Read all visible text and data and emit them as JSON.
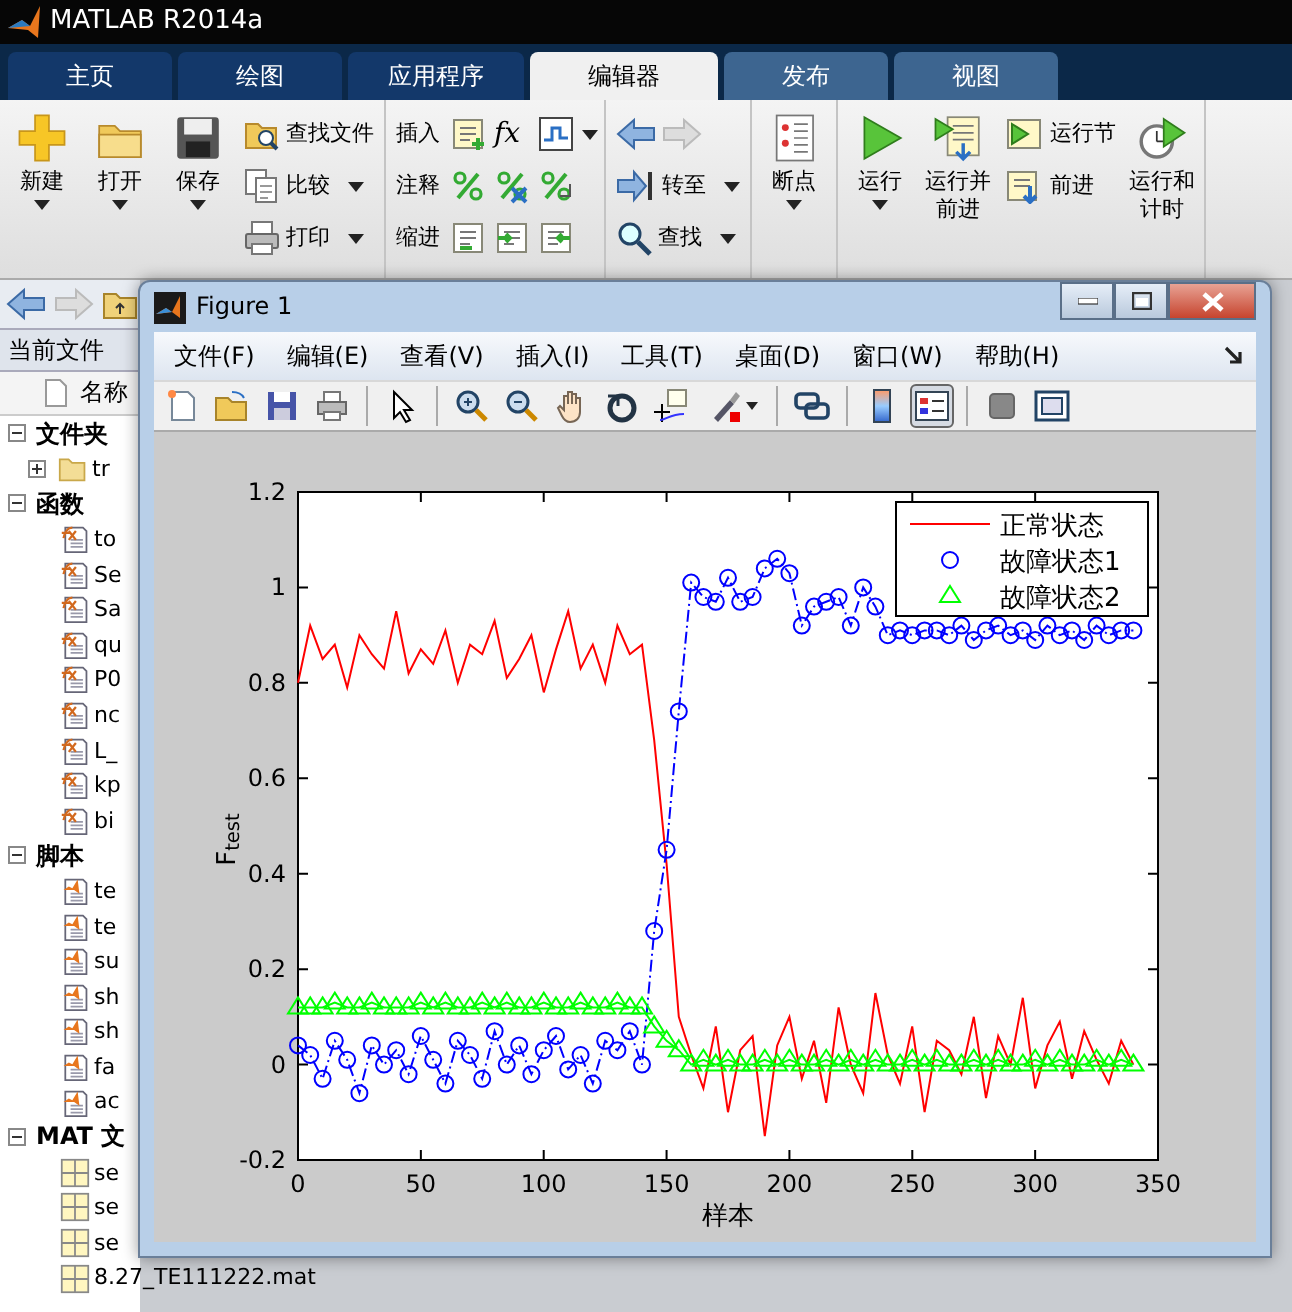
{
  "app": {
    "title": "MATLAB R2014a"
  },
  "tabs": [
    {
      "label": "主页",
      "selected": false,
      "contextual": false
    },
    {
      "label": "绘图",
      "selected": false,
      "contextual": false
    },
    {
      "label": "应用程序",
      "selected": false,
      "contextual": false
    },
    {
      "label": "编辑器",
      "selected": true,
      "contextual": true
    },
    {
      "label": "发布",
      "selected": false,
      "contextual": true
    },
    {
      "label": "视图",
      "selected": false,
      "contextual": true
    }
  ],
  "toolstrip": {
    "groups": [
      {
        "columns": [
          {
            "kind": "large",
            "label": "新建",
            "caret": true
          },
          {
            "kind": "large",
            "label": "打开",
            "caret": true
          },
          {
            "kind": "large",
            "label": "保存",
            "caret": true
          },
          {
            "kind": "stack",
            "rows": [
              {
                "kind": "text",
                "label": "查找文件",
                "caret": false
              },
              {
                "kind": "text",
                "label": "比较",
                "caret": true
              },
              {
                "kind": "text",
                "label": "打印",
                "caret": true
              }
            ]
          }
        ]
      },
      {
        "columns": [
          {
            "kind": "stack",
            "rows": [
              {
                "kind": "text",
                "label": "插入",
                "caret": false
              },
              {
                "kind": "text",
                "label": "注释",
                "caret": false
              },
              {
                "kind": "text",
                "label": "缩进",
                "caret": false
              }
            ]
          },
          {
            "kind": "icon-grid",
            "function_label": "fx",
            "caret": true
          }
        ]
      },
      {
        "columns": [
          {
            "kind": "stack",
            "rows": [
              {
                "kind": "arrows"
              },
              {
                "kind": "text",
                "label": "转至",
                "caret": true
              },
              {
                "kind": "text",
                "label": "查找",
                "caret": true
              }
            ]
          }
        ]
      },
      {
        "columns": [
          {
            "kind": "large",
            "label": "断点",
            "caret": true
          }
        ]
      },
      {
        "columns": [
          {
            "kind": "large",
            "label": "运行",
            "caret": true
          },
          {
            "kind": "large",
            "label": "运行并前进",
            "caret": false
          },
          {
            "kind": "stack",
            "rows": [
              {
                "kind": "text",
                "label": "运行节",
                "caret": false
              },
              {
                "kind": "text",
                "label": "前进",
                "caret": false
              }
            ]
          },
          {
            "kind": "large",
            "label": "运行和计时",
            "caret": false
          }
        ]
      }
    ]
  },
  "current_folder": {
    "title": "当前文件",
    "column": "名称",
    "sections": [
      {
        "label": "文件夹",
        "kind": "folder",
        "expanded": true,
        "items": [
          {
            "label": "tr",
            "expanded": false
          }
        ]
      },
      {
        "label": "函数",
        "kind": "function",
        "expanded": true,
        "items": [
          {
            "label": "to"
          },
          {
            "label": "Se"
          },
          {
            "label": "Sa"
          },
          {
            "label": "qu"
          },
          {
            "label": "P0"
          },
          {
            "label": "nc"
          },
          {
            "label": "L_"
          },
          {
            "label": "kp"
          },
          {
            "label": "bi"
          }
        ]
      },
      {
        "label": "脚本",
        "kind": "script",
        "expanded": true,
        "items": [
          {
            "label": "te"
          },
          {
            "label": "te"
          },
          {
            "label": "su"
          },
          {
            "label": "sh"
          },
          {
            "label": "sh"
          },
          {
            "label": "fa"
          },
          {
            "label": "ac"
          }
        ]
      },
      {
        "label": "MAT 文",
        "kind": "mat",
        "expanded": true,
        "items": [
          {
            "label": "se"
          },
          {
            "label": "se"
          },
          {
            "label": "se"
          },
          {
            "label": "8.27_TE111222.mat"
          }
        ]
      }
    ]
  },
  "figure": {
    "title": "Figure 1",
    "menus": [
      "文件(F)",
      "编辑(E)",
      "查看(V)",
      "插入(I)",
      "工具(T)",
      "桌面(D)",
      "窗口(W)",
      "帮助(H)"
    ],
    "toolbar": [
      [
        {
          "pressed": false
        },
        {
          "pressed": false
        },
        {
          "pressed": false
        },
        {
          "pressed": false
        }
      ],
      [
        {
          "pressed": false
        }
      ],
      [
        {
          "pressed": false
        },
        {
          "pressed": false
        },
        {
          "pressed": false
        },
        {
          "pressed": false
        },
        {
          "pressed": false
        },
        {
          "pressed": false,
          "caret": true
        }
      ],
      [
        {
          "pressed": false
        }
      ],
      [
        {
          "pressed": false
        },
        {
          "pressed": true
        }
      ],
      [
        {
          "pressed": false
        },
        {
          "pressed": false
        }
      ]
    ],
    "chart_data": {
      "type": "line",
      "legend": true,
      "xlabel": "样本",
      "ylabel": "F$_{test}$",
      "xlim": [
        0,
        350
      ],
      "ylim": [
        -0.2,
        1.2
      ],
      "xticks": [
        0,
        50,
        100,
        150,
        200,
        250,
        300,
        350
      ],
      "yticks": [
        -0.2,
        0,
        0.2,
        0.4,
        0.6,
        0.8,
        1,
        1.2
      ],
      "x": [
        0,
        5,
        10,
        15,
        20,
        25,
        30,
        35,
        40,
        45,
        50,
        55,
        60,
        65,
        70,
        75,
        80,
        85,
        90,
        95,
        100,
        105,
        110,
        115,
        120,
        125,
        130,
        135,
        140,
        145,
        150,
        155,
        160,
        165,
        170,
        175,
        180,
        185,
        190,
        195,
        200,
        205,
        210,
        215,
        220,
        225,
        230,
        235,
        240,
        245,
        250,
        255,
        260,
        265,
        270,
        275,
        280,
        285,
        290,
        295,
        300,
        305,
        310,
        315,
        320,
        325,
        330,
        335,
        340
      ],
      "series": [
        {
          "name": "正常状态",
          "color": "#ff0000",
          "marker": "none",
          "line_style": "solid",
          "values": [
            0.8,
            0.92,
            0.85,
            0.88,
            0.79,
            0.9,
            0.86,
            0.83,
            0.95,
            0.82,
            0.87,
            0.84,
            0.91,
            0.8,
            0.88,
            0.86,
            0.93,
            0.81,
            0.85,
            0.9,
            0.78,
            0.87,
            0.95,
            0.83,
            0.88,
            0.8,
            0.92,
            0.86,
            0.88,
            0.68,
            0.42,
            0.1,
            0.02,
            -0.05,
            0.08,
            -0.1,
            0.03,
            0.06,
            -0.15,
            0.04,
            0.1,
            -0.03,
            0.05,
            -0.08,
            0.12,
            0.0,
            -0.06,
            0.15,
            0.02,
            -0.04,
            0.08,
            -0.1,
            0.05,
            0.03,
            -0.02,
            0.1,
            -0.07,
            0.06,
            0.0,
            0.14,
            -0.05,
            0.04,
            0.09,
            -0.03,
            0.07,
            0.01,
            -0.04,
            0.05,
            0.0
          ]
        },
        {
          "name": "故障状态1",
          "color": "#0000ff",
          "marker": "circle",
          "line_style": "dashdot",
          "values": [
            0.04,
            0.02,
            -0.03,
            0.05,
            0.01,
            -0.06,
            0.04,
            0.0,
            0.03,
            -0.02,
            0.06,
            0.01,
            -0.04,
            0.05,
            0.02,
            -0.03,
            0.07,
            0.0,
            0.04,
            -0.02,
            0.03,
            0.06,
            -0.01,
            0.02,
            -0.04,
            0.05,
            0.03,
            0.07,
            0.0,
            0.28,
            0.45,
            0.74,
            1.01,
            0.98,
            0.97,
            1.02,
            0.97,
            0.98,
            1.04,
            1.06,
            1.03,
            0.92,
            0.96,
            0.97,
            0.98,
            0.92,
            1.0,
            0.96,
            0.9,
            0.91,
            0.9,
            0.91,
            0.91,
            0.9,
            0.92,
            0.89,
            0.91,
            0.92,
            0.9,
            0.91,
            0.89,
            0.92,
            0.9,
            0.91,
            0.89,
            0.92,
            0.9,
            0.91,
            0.91
          ]
        },
        {
          "name": "故障状态2",
          "color": "#00ff00",
          "marker": "triangle",
          "line_style": "solid",
          "values": [
            0.12,
            0.12,
            0.12,
            0.13,
            0.12,
            0.12,
            0.13,
            0.12,
            0.12,
            0.12,
            0.13,
            0.12,
            0.13,
            0.12,
            0.12,
            0.13,
            0.12,
            0.13,
            0.12,
            0.12,
            0.13,
            0.12,
            0.12,
            0.13,
            0.12,
            0.12,
            0.13,
            0.12,
            0.12,
            0.08,
            0.05,
            0.03,
            0.0,
            0.01,
            0.0,
            0.01,
            0.0,
            0.0,
            0.01,
            0.0,
            0.01,
            0.0,
            0.0,
            0.01,
            0.0,
            0.01,
            0.0,
            0.01,
            0.0,
            0.0,
            0.01,
            0.0,
            0.01,
            0.0,
            0.0,
            0.01,
            0.0,
            0.01,
            0.0,
            0.0,
            0.01,
            0.0,
            0.01,
            0.0,
            0.0,
            0.01,
            0.0,
            0.01,
            0.0
          ]
        }
      ]
    }
  }
}
